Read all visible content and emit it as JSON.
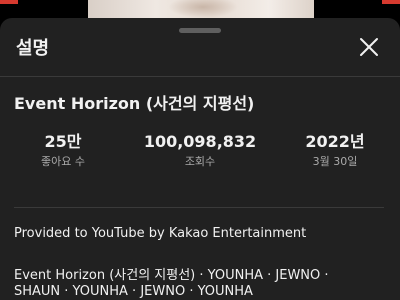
{
  "sheet": {
    "title": "설명",
    "close_icon": "close-icon"
  },
  "video": {
    "title": "Event Horizon (사건의 지평선)"
  },
  "stats": {
    "likes_value": "25만",
    "likes_label": "좋아요 수",
    "views_value": "100,098,832",
    "views_label": "조회수",
    "date_year": "2022년",
    "date_day": "3월 30일"
  },
  "description": {
    "line1": "Provided to YouTube by Kakao Entertainment",
    "line2": "Event Horizon (사건의 지평선) · YOUNHA · JEWNO ·",
    "line3": "SHAUN · YOUNHA · JEWNO · YOUNHA"
  },
  "colors": {
    "background": "#000000",
    "sheet": "#212121",
    "text_primary": "#f1f1f1",
    "text_secondary": "#aaaaaa"
  }
}
